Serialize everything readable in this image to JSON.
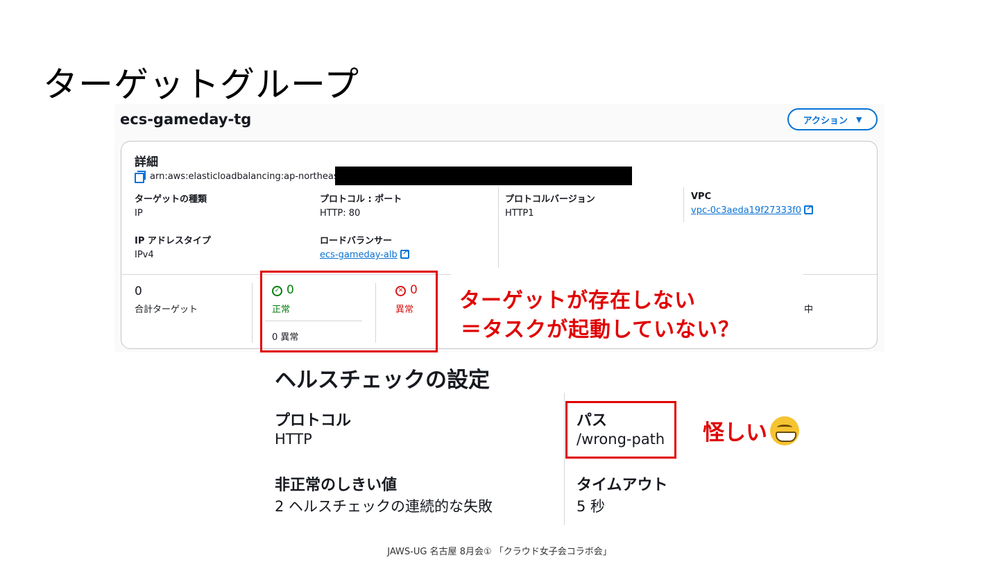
{
  "slide": {
    "title": "ターゲットグループ",
    "footer": "JAWS-UG 名古屋 8月会① 「クラウド女子会コラボ会」"
  },
  "console": {
    "target_group_name": "ecs-gameday-tg",
    "action_button": "アクション",
    "details": {
      "title": "詳細",
      "arn_prefix": "arn:aws:elasticloadbalancing:ap-northeast-",
      "fields": {
        "target_type": {
          "label": "ターゲットの種類",
          "value": "IP"
        },
        "protocol_port": {
          "label": "プロトコル : ポート",
          "value": "HTTP: 80"
        },
        "protocol_version": {
          "label": "プロトコルバージョン",
          "value": "HTTP1"
        },
        "vpc": {
          "label": "VPC",
          "value": "vpc-0c3aeda19f27333f0"
        },
        "ip_address_type": {
          "label": "IP アドレスタイプ",
          "value": "IPv4"
        },
        "load_balancer": {
          "label": "ロードバランサー",
          "value": "ecs-gameday-alb"
        }
      },
      "stats": {
        "total": {
          "value": "0",
          "label": "合計ターゲット"
        },
        "healthy": {
          "value": "0",
          "label": "正常"
        },
        "healthy_anomaly": "0 異常",
        "unhealthy": {
          "value": "0",
          "label": "異常"
        },
        "partial_right": "中"
      }
    }
  },
  "annotations": {
    "callout_line1": "ターゲットが存在しない",
    "callout_line2": "＝タスクが起動していない？",
    "suspicious": "怪しい"
  },
  "health_check": {
    "title": "ヘルスチェックの設定",
    "protocol": {
      "label": "プロトコル",
      "value": "HTTP"
    },
    "path": {
      "label": "パス",
      "value": "/wrong-path"
    },
    "unhealthy_threshold": {
      "label": "非正常のしきい値",
      "value": "2 ヘルスチェックの連続的な失敗"
    },
    "timeout": {
      "label": "タイムアウト",
      "value": "5 秒"
    }
  },
  "colors": {
    "annotation_red": "#e00000",
    "aws_link_blue": "#0972d3",
    "healthy_green": "#037f0c",
    "unhealthy_red": "#d91515"
  }
}
